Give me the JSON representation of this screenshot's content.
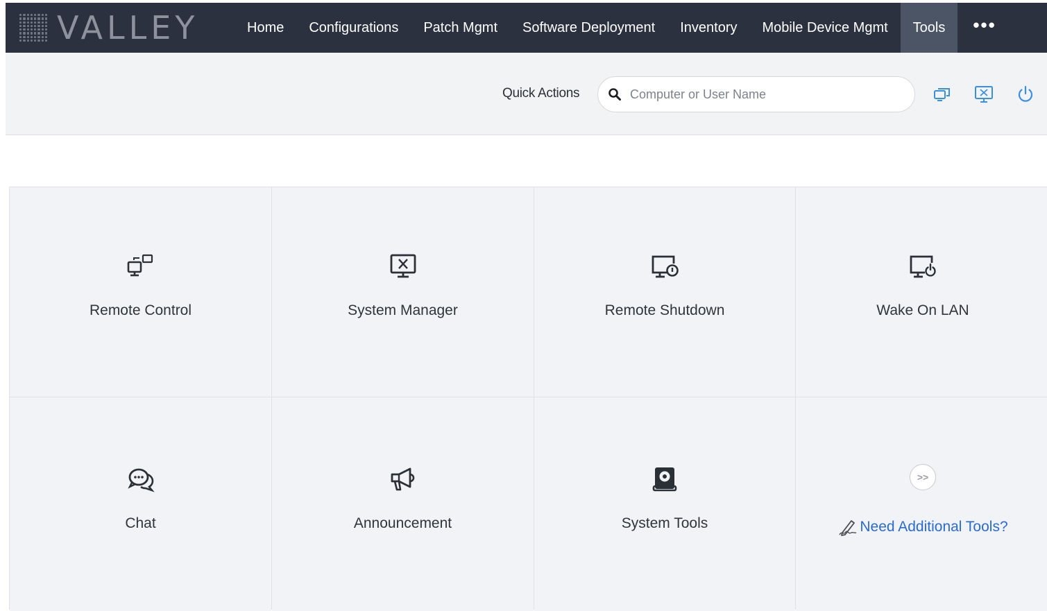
{
  "brand": {
    "name": "VALLEY"
  },
  "nav": {
    "items": [
      {
        "label": "Home",
        "active": false
      },
      {
        "label": "Configurations",
        "active": false
      },
      {
        "label": "Patch Mgmt",
        "active": false
      },
      {
        "label": "Software Deployment",
        "active": false
      },
      {
        "label": "Inventory",
        "active": false
      },
      {
        "label": "Mobile Device Mgmt",
        "active": false
      },
      {
        "label": "Tools",
        "active": true
      }
    ],
    "more_label": "•••"
  },
  "quick_actions": {
    "label": "Quick Actions",
    "search_placeholder": "Computer or User Name",
    "icons": [
      "remote-control-icon",
      "system-manager-icon",
      "power-icon"
    ],
    "icon_color": "#3a8fe0"
  },
  "tools": {
    "tiles": [
      {
        "label": "Remote Control",
        "icon": "remote-control-icon"
      },
      {
        "label": "System Manager",
        "icon": "system-manager-icon"
      },
      {
        "label": "Remote Shutdown",
        "icon": "remote-shutdown-icon"
      },
      {
        "label": "Wake On LAN",
        "icon": "wake-on-lan-icon"
      },
      {
        "label": "Chat",
        "icon": "chat-icon"
      },
      {
        "label": "Announcement",
        "icon": "megaphone-icon"
      },
      {
        "label": "System Tools",
        "icon": "system-tools-icon"
      }
    ],
    "more_tools": {
      "badge": ">>",
      "link_label": "Need Additional Tools?"
    }
  },
  "colors": {
    "nav_bg": "#2b313e",
    "nav_active_bg": "#4b5566",
    "link": "#2a6bd0",
    "tile_bg": "#f2f3f6"
  }
}
